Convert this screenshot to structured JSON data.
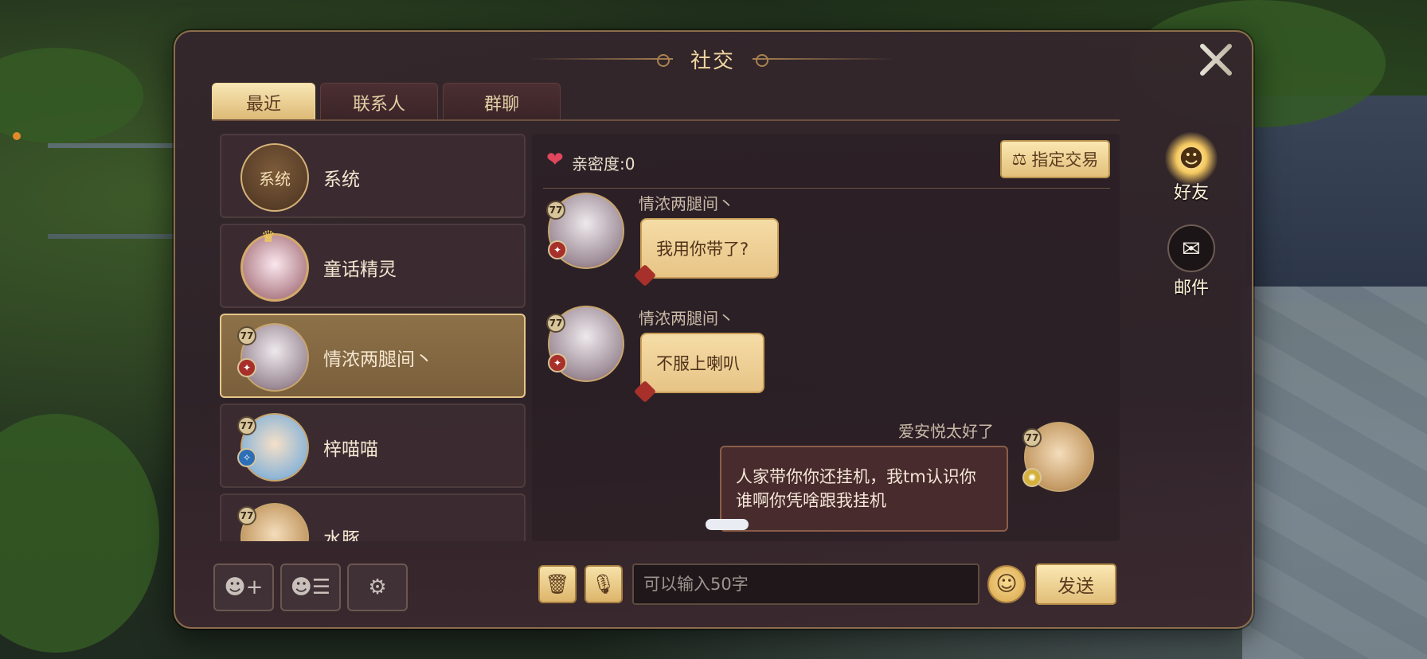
{
  "window": {
    "title": "社交"
  },
  "tabs": [
    {
      "label": "最近",
      "active": true
    },
    {
      "label": "联系人",
      "active": false
    },
    {
      "label": "群聊",
      "active": false
    }
  ],
  "contacts": [
    {
      "name": "系统",
      "avatar_text": "系统",
      "selected": false
    },
    {
      "name": "童话精灵",
      "selected": false
    },
    {
      "name": "情浓两腿间丶",
      "level": "77",
      "element": "fire",
      "selected": true
    },
    {
      "name": "梓喵喵",
      "level": "77",
      "element": "water",
      "selected": false
    },
    {
      "name": "水豚",
      "level": "77",
      "selected": false
    }
  ],
  "chat": {
    "intimacy_label": "亲密度:0",
    "trade_button": "指定交易",
    "messages": [
      {
        "sender": "情浓两腿间丶",
        "level": "77",
        "text": "我用你带了?",
        "mine": false
      },
      {
        "sender": "情浓两腿间丶",
        "level": "77",
        "text": "不服上喇叭",
        "mine": false
      },
      {
        "sender": "爱安悦太好了",
        "level": "77",
        "text": "人家带你你还挂机，我tm认识你谁啊你凭啥跟我挂机",
        "mine": true
      }
    ]
  },
  "input": {
    "placeholder": "可以输入50字",
    "value": ""
  },
  "send_button": "发送",
  "side_nav": [
    {
      "label": "好友",
      "icon": "friend-avatar-icon",
      "active": true
    },
    {
      "label": "邮件",
      "icon": "mail-feather-icon",
      "active": false
    }
  ],
  "colors": {
    "accent_gold": "#e1be78",
    "panel_bg": "#34262c",
    "heart": "#e0475c",
    "fire_element": "#a8302a",
    "water_element": "#2c6fb7"
  }
}
